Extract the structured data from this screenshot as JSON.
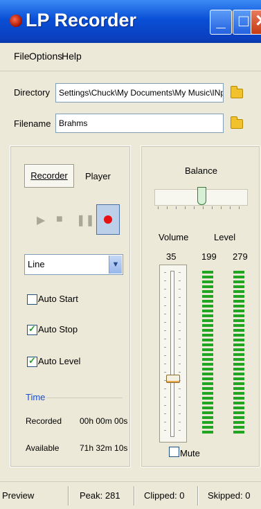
{
  "window": {
    "title": "LP Recorder"
  },
  "menu": [
    "File",
    "Options",
    "Help"
  ],
  "paths": {
    "directory_label": "Directory",
    "directory_value": "Settings\\Chuck\\My Documents\\My Music\\INport",
    "filename_label": "Filename",
    "filename_value": "Brahms"
  },
  "tabs": {
    "recorder": "Recorder",
    "player": "Player"
  },
  "recorder": {
    "source": "Line",
    "checkboxes": [
      {
        "label": "Auto Start",
        "checked": false
      },
      {
        "label": "Auto Stop",
        "checked": true
      },
      {
        "label": "Auto Level",
        "checked": true
      }
    ],
    "time_title": "Time",
    "recorded_label": "Recorded",
    "recorded_value": "00h 00m 00s",
    "available_label": "Available",
    "available_value": "71h 32m 10s"
  },
  "mixer": {
    "balance_label": "Balance",
    "volume_label": "Volume",
    "level_label": "Level",
    "volume_value": "35",
    "level_left": "199",
    "level_right": "279",
    "volume_fraction": 0.35,
    "mute_label": "Mute",
    "mute_checked": false
  },
  "status": {
    "preview": "Preview",
    "peak": "Peak: 281",
    "clipped": "Clipped: 0",
    "skipped": "Skipped: 0"
  },
  "colors": {
    "titlebar": "#0A4FD6",
    "meter": "#1FA51F",
    "record": "#E81010"
  }
}
